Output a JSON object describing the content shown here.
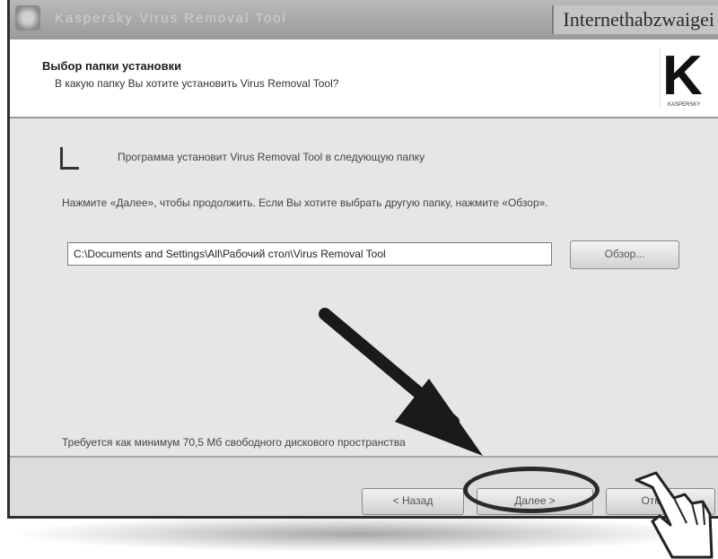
{
  "window": {
    "title": "Kaspersky Virus Removal Tool",
    "watermark": "Internethabzwaigei"
  },
  "header": {
    "title": "Выбор папки установки",
    "subtitle": "В какую папку Вы хотите установить Virus Removal Tool?",
    "logo_letter": "K",
    "logo_caption": "KASPERSKY"
  },
  "content": {
    "info_text": "Программа установит Virus Removal Tool в следующую папку",
    "instruction": "Нажмите «Далее», чтобы продолжить. Если Вы хотите выбрать другую папку, нажмите «Обзор».",
    "path_value": "C:\\Documents and Settings\\All\\Рабочий стол\\Virus Removal Tool",
    "browse_label": "Обзор...",
    "space_text": "Требуется как минимум 70,5 Мб свободного дискового пространства"
  },
  "footer": {
    "back_label": "< Назад",
    "next_label": "Далее >",
    "cancel_label": "Отмена"
  },
  "icons": {
    "arrow": "arrow-down-right-icon",
    "cursor": "hand-cursor-icon"
  },
  "colors": {
    "window_bg": "#e6e6e6",
    "header_bg": "#ffffff",
    "frame": "#2f2f2f",
    "annotation": "#1a1a1a"
  }
}
